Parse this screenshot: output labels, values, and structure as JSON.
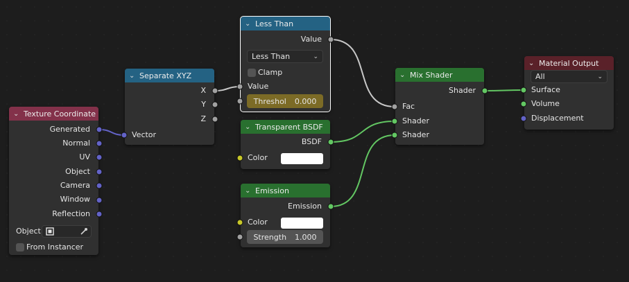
{
  "nodes": {
    "texture_coordinate": {
      "title": "Texture Coordinate",
      "outputs": [
        "Generated",
        "Normal",
        "UV",
        "Object",
        "Camera",
        "Window",
        "Reflection"
      ],
      "object_label": "Object:",
      "from_instancer": "From Instancer"
    },
    "separate_xyz": {
      "title": "Separate XYZ",
      "outputs": [
        "X",
        "Y",
        "Z"
      ],
      "input": "Vector"
    },
    "less_than": {
      "title": "Less Than",
      "output": "Value",
      "operation": "Less Than",
      "clamp": "Clamp",
      "input": "Value",
      "threshold_label": "Threshol",
      "threshold_value": "0.000"
    },
    "transparent_bsdf": {
      "title": "Transparent BSDF",
      "output": "BSDF",
      "color_label": "Color",
      "color": "#ffffff"
    },
    "emission": {
      "title": "Emission",
      "output": "Emission",
      "color_label": "Color",
      "color": "#ffffff",
      "strength_label": "Strength",
      "strength_value": "1.000"
    },
    "mix_shader": {
      "title": "Mix Shader",
      "output": "Shader",
      "inputs": [
        "Fac",
        "Shader",
        "Shader"
      ]
    },
    "material_output": {
      "title": "Material Output",
      "target": "All",
      "inputs": [
        "Surface",
        "Volume",
        "Displacement"
      ]
    }
  },
  "colors": {
    "background": "#1d1d1d",
    "header_converter": "#246283",
    "header_shader": "#29702f",
    "header_input": "#83314a",
    "header_output": "#5a2129",
    "socket_float": "#a1a1a1",
    "socket_shader": "#63c763",
    "socket_vector": "#6363c7",
    "socket_color": "#c7c729"
  }
}
